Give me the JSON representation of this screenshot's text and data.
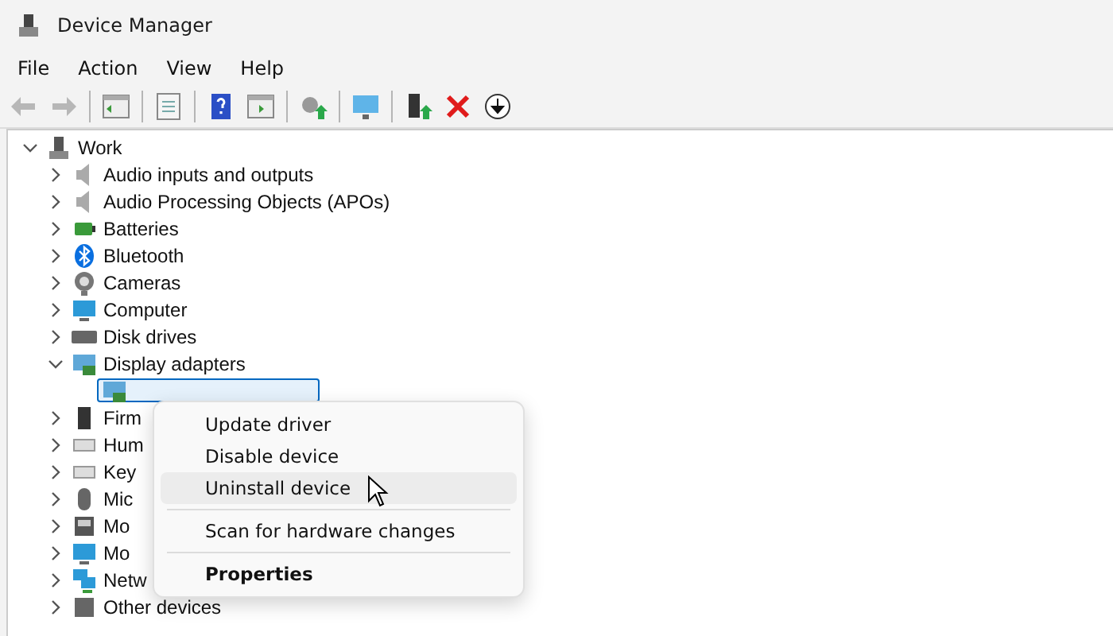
{
  "window": {
    "title": "Device Manager"
  },
  "menu_bar": [
    "File",
    "Action",
    "View",
    "Help"
  ],
  "toolbar": [
    {
      "kind": "back",
      "disabled": true
    },
    {
      "kind": "forward",
      "disabled": true
    },
    {
      "kind": "separator"
    },
    {
      "kind": "console-tree",
      "disabled": false
    },
    {
      "kind": "separator"
    },
    {
      "kind": "properties",
      "disabled": false
    },
    {
      "kind": "separator"
    },
    {
      "kind": "help",
      "disabled": false
    },
    {
      "kind": "action-pane",
      "disabled": false
    },
    {
      "kind": "separator"
    },
    {
      "kind": "scan",
      "disabled": false
    },
    {
      "kind": "separator"
    },
    {
      "kind": "monitor",
      "disabled": false
    },
    {
      "kind": "separator"
    },
    {
      "kind": "update",
      "disabled": false
    },
    {
      "kind": "uninstall",
      "disabled": false
    },
    {
      "kind": "download",
      "disabled": false
    }
  ],
  "tree": {
    "label": "Work",
    "kind": "computer-tower",
    "expanded": true,
    "selected": false,
    "children": [
      {
        "label": "Audio inputs and outputs",
        "kind": "speaker",
        "expanded": false,
        "selected": false
      },
      {
        "label": "Audio Processing Objects (APOs)",
        "kind": "speaker",
        "expanded": false,
        "selected": false
      },
      {
        "label": "Batteries",
        "kind": "battery",
        "expanded": false,
        "selected": false
      },
      {
        "label": "Bluetooth",
        "kind": "bluetooth",
        "expanded": false,
        "selected": false
      },
      {
        "label": "Cameras",
        "kind": "camera",
        "expanded": false,
        "selected": false
      },
      {
        "label": "Computer",
        "kind": "monitor",
        "expanded": false,
        "selected": false
      },
      {
        "label": "Disk drives",
        "kind": "disk",
        "expanded": false,
        "selected": false
      },
      {
        "label": "Display adapters",
        "kind": "display",
        "expanded": true,
        "selected": false,
        "children": [
          {
            "kind": "display",
            "selected": true
          }
        ]
      },
      {
        "label": "Firm",
        "kind": "chip",
        "expanded": false,
        "selected": false
      },
      {
        "label": "Hum",
        "kind": "keyboard",
        "expanded": false,
        "selected": false
      },
      {
        "label": "Key",
        "kind": "keyboard",
        "expanded": false,
        "selected": false
      },
      {
        "label": "Mic",
        "kind": "mouse",
        "expanded": false,
        "selected": false
      },
      {
        "label": "Mo",
        "kind": "phone",
        "expanded": false,
        "selected": false
      },
      {
        "label": "Mo",
        "kind": "monitor",
        "expanded": false,
        "selected": false
      },
      {
        "label": "Netw",
        "kind": "network",
        "expanded": false,
        "selected": false
      },
      {
        "label": "Other devices",
        "kind": "unknown",
        "expanded": false,
        "selected": false
      }
    ]
  },
  "context_menu": [
    {
      "kind": "item",
      "label": "Update driver",
      "highlighted": false,
      "default": false
    },
    {
      "kind": "item",
      "label": "Disable device",
      "highlighted": false,
      "default": false
    },
    {
      "kind": "item",
      "label": "Uninstall device",
      "highlighted": true,
      "default": false
    },
    {
      "kind": "separator"
    },
    {
      "kind": "item",
      "label": "Scan for hardware changes",
      "highlighted": false,
      "default": false
    },
    {
      "kind": "separator"
    },
    {
      "kind": "item",
      "label": "Properties",
      "highlighted": false,
      "default": true
    }
  ]
}
